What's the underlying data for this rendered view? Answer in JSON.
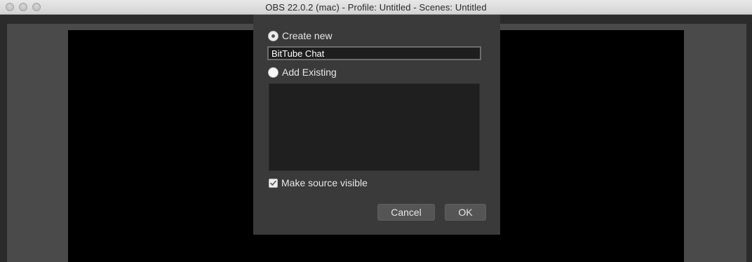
{
  "window": {
    "title": "OBS 22.0.2 (mac) - Profile: Untitled - Scenes: Untitled"
  },
  "dialog": {
    "create_new_label": "Create new",
    "create_new_selected": true,
    "name_value": "BitTube Chat",
    "add_existing_label": "Add Existing",
    "add_existing_selected": false,
    "existing_sources": [],
    "make_visible_label": "Make source visible",
    "make_visible_checked": true,
    "cancel_label": "Cancel",
    "ok_label": "OK"
  },
  "colors": {
    "dialog_bg": "#3a3a3a",
    "canvas_bg": "#000000",
    "button_bg": "#555555"
  }
}
